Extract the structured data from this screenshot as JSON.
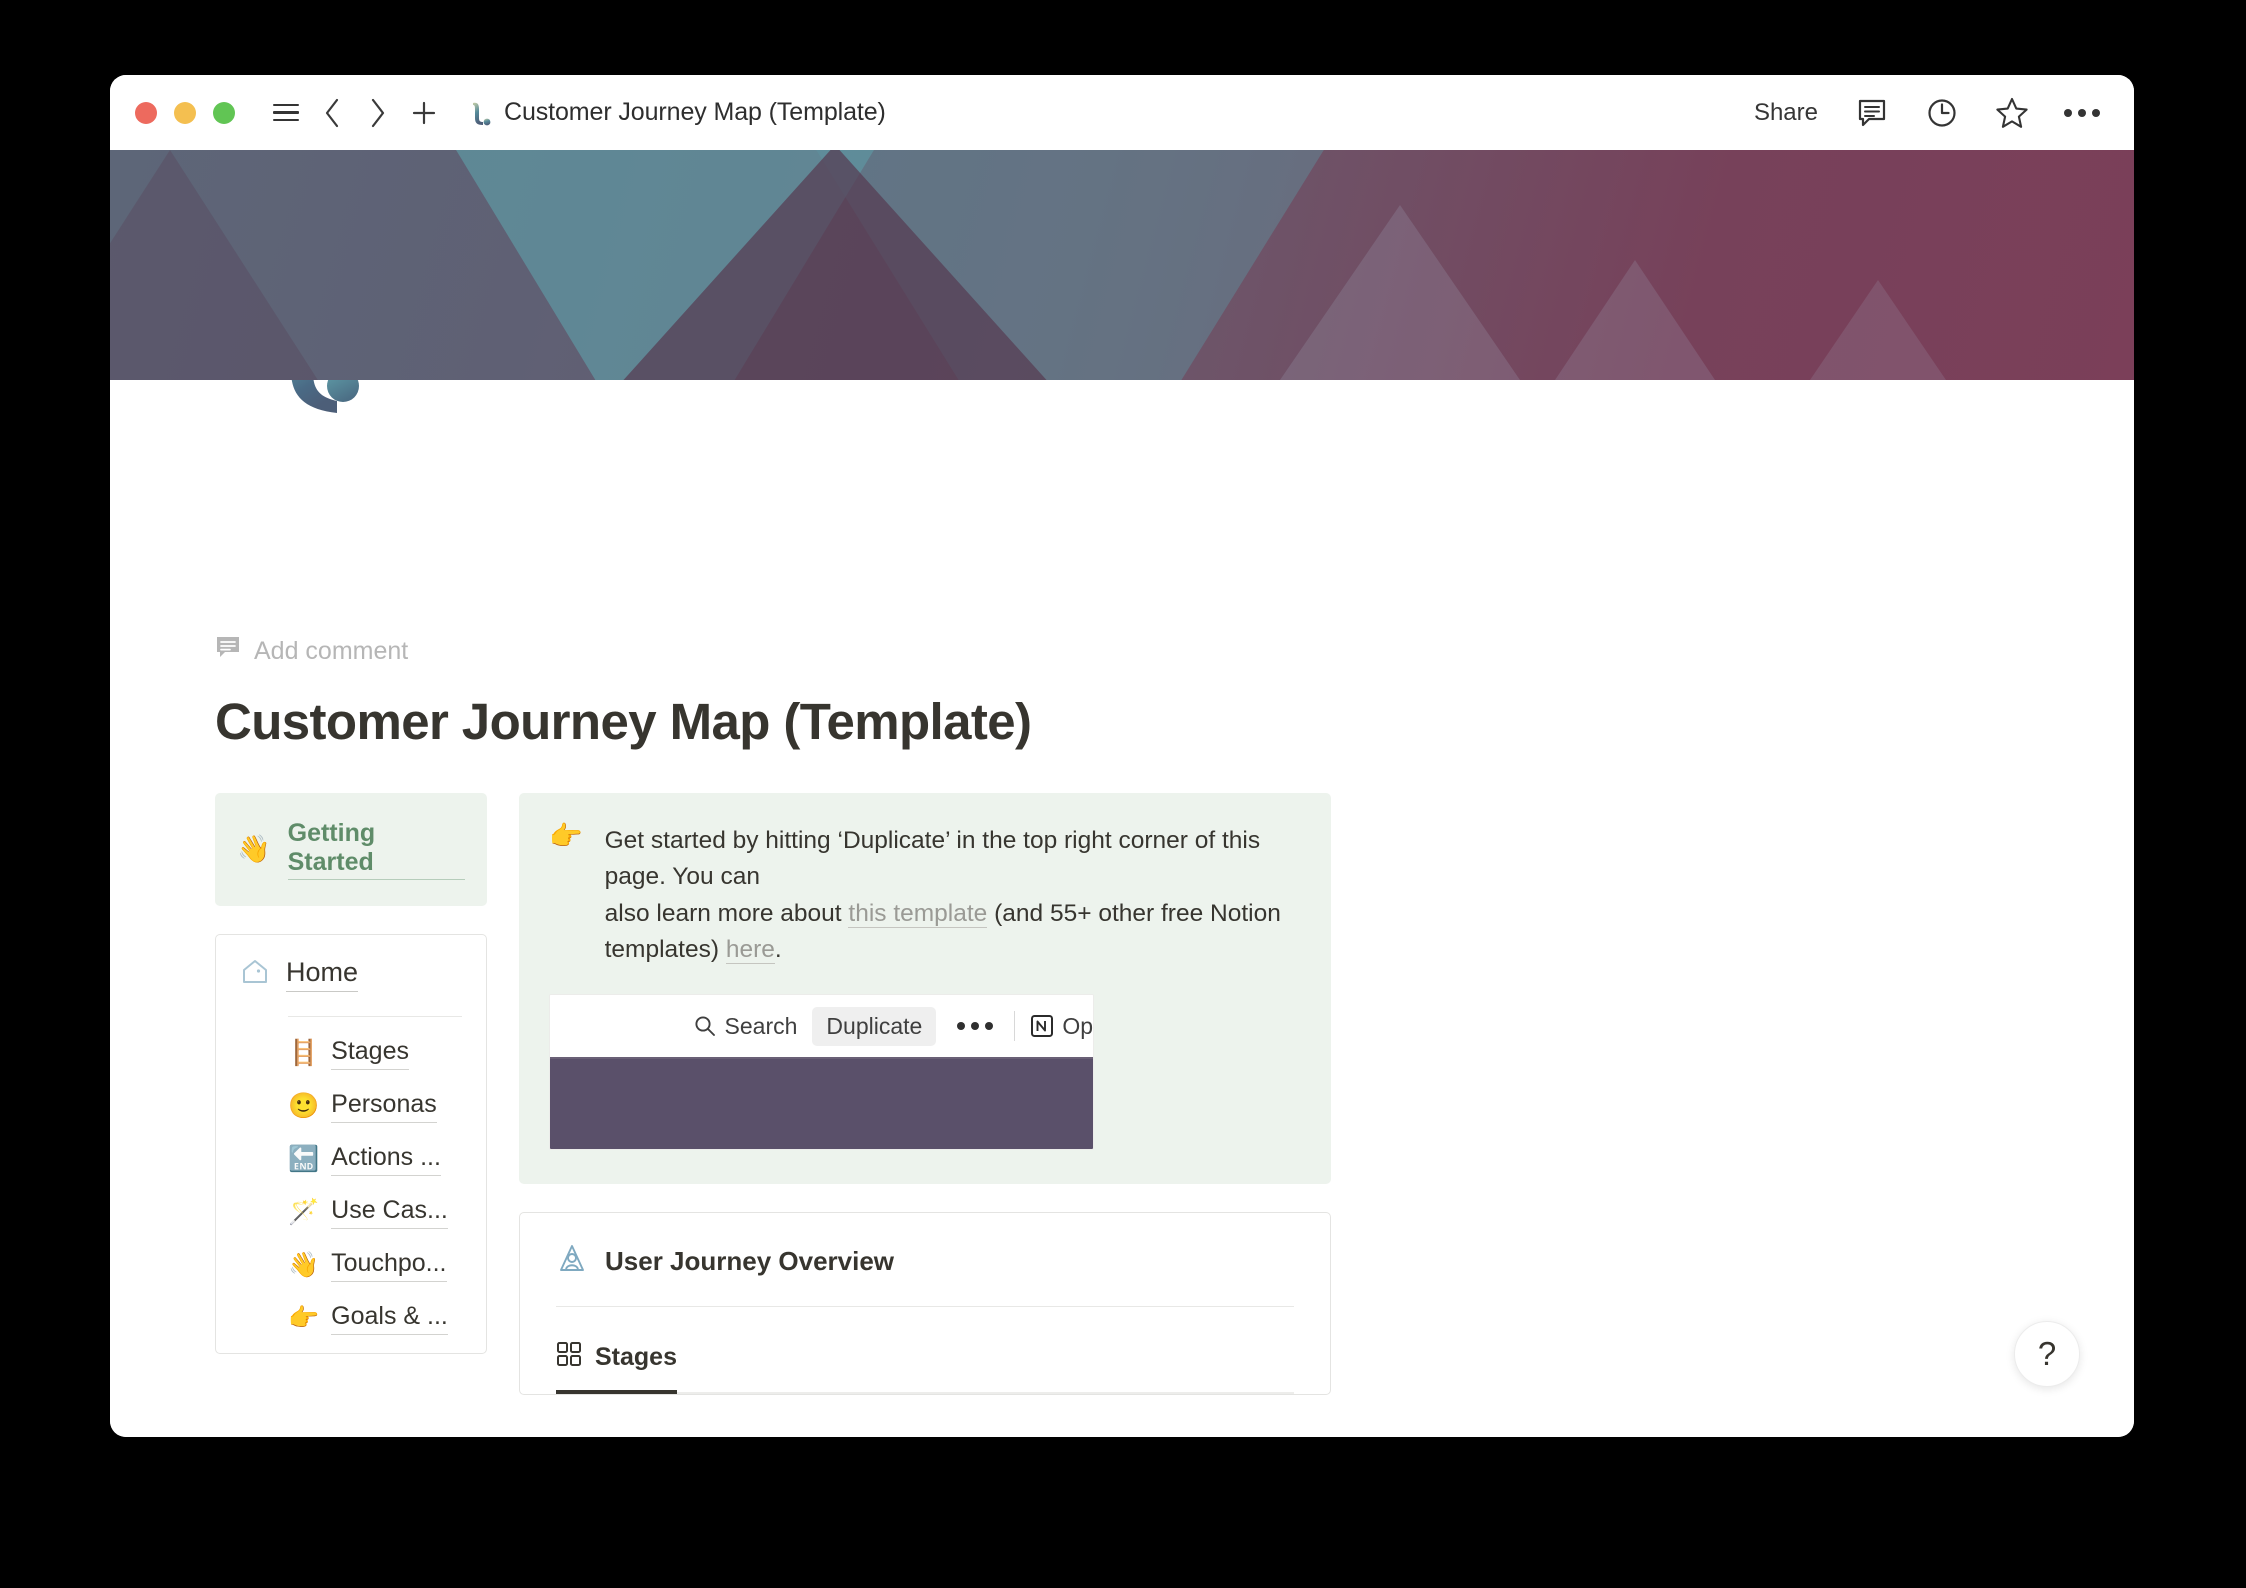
{
  "window": {
    "titlebar": {
      "traffic_lights": [
        "close",
        "minimize",
        "zoom"
      ],
      "title": "Customer Journey Map (Template)",
      "share_label": "Share",
      "icons": [
        "sidebar-toggle-icon",
        "back-icon",
        "forward-icon",
        "new-page-icon",
        "comments-icon",
        "history-icon",
        "favorite-icon",
        "more-icon"
      ]
    }
  },
  "page": {
    "add_comment": "Add comment",
    "title": "Customer Journey Map (Template)",
    "icon_alt": "l."
  },
  "left_column": {
    "getting_started": {
      "emoji": "👋",
      "label": "Getting Started"
    },
    "nav": {
      "home_label": "Home",
      "items": [
        {
          "emoji": "🪜",
          "label": "Stages"
        },
        {
          "emoji": "🙂",
          "label": "Personas"
        },
        {
          "emoji": "🔚",
          "label": "Actions ..."
        },
        {
          "emoji": "🪄",
          "label": "Use Cas..."
        },
        {
          "emoji": "👋",
          "label": "Touchpo..."
        },
        {
          "emoji": "👉",
          "label": "Goals & ..."
        }
      ]
    }
  },
  "right_column": {
    "callout": {
      "emoji": "👉",
      "line1_a": "Get started by hitting ‘Duplicate’ in the top right corner of this page. You can",
      "line2_a": "also learn more about ",
      "link1": "this template",
      "line2_b": " (and 55+ other free Notion templates) ",
      "link2": "here",
      "line2_c": "."
    },
    "embed": {
      "search_label": "Search",
      "duplicate_label": "Duplicate",
      "more_label": "•••",
      "notion_label": "Op"
    },
    "user_journey": {
      "title": "User Journey Overview",
      "icon": "person-pin-icon",
      "tabs": [
        {
          "icon": "gallery-grid-icon",
          "label": "Stages",
          "active": true
        }
      ]
    }
  },
  "help": {
    "label": "?"
  },
  "colors": {
    "accent_green": "#5F8C69",
    "callout_bg": "#EDF3ED",
    "text": "#37352f",
    "traffic_red": "#ED6A5E",
    "traffic_yellow": "#F4BF50",
    "traffic_green": "#61C554",
    "embed_band": "#5A506A"
  }
}
